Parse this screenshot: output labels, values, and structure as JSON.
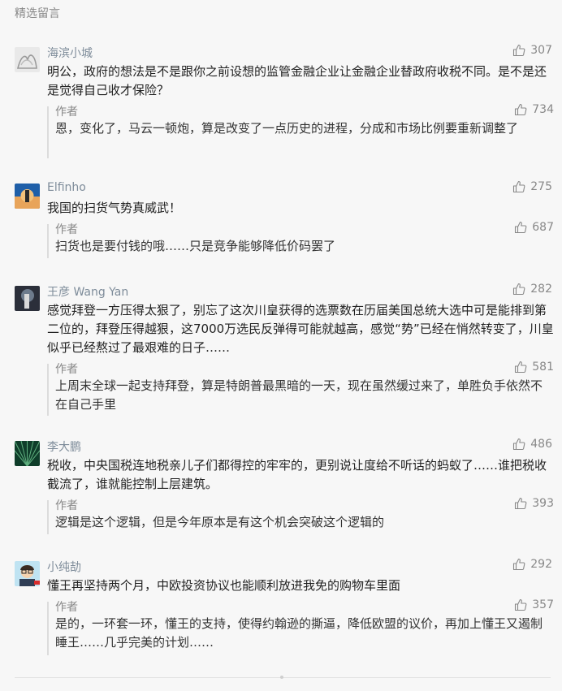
{
  "section_title": "精选留言",
  "comments": [
    {
      "name": "海滨小城",
      "likes": "307",
      "text": "明公，政府的想法是不是跟你之前设想的监管金融企业让金融企业替政府收税不同。是不是还是觉得自己收才保险？",
      "reply": {
        "author": "作者",
        "likes": "734",
        "text": "恩，变化了，马云一顿炮，算是改变了一点历史的进程，分成和市场比例要重新调整了"
      }
    },
    {
      "name": "Elfinho",
      "likes": "275",
      "text": "我国的扫货气势真威武！",
      "reply": {
        "author": "作者",
        "likes": "687",
        "text": "扫货也是要付钱的哦……只是竞争能够降低价码罢了"
      }
    },
    {
      "name": "王彦 Wang Yan",
      "likes": "282",
      "text": "感觉拜登一方压得太狠了，别忘了这次川皇获得的选票数在历届美国总统大选中可是能排到第二位的，拜登压得越狠，这7000万选民反弹得可能就越高，感觉“势”已经在悄然转变了，川皇似乎已经熬过了最艰难的日子……",
      "reply": {
        "author": "作者",
        "likes": "581",
        "text": "上周末全球一起支持拜登，算是特朗普最黑暗的一天，现在虽然缓过来了，单胜负手依然不在自己手里"
      }
    },
    {
      "name": "李大鹏",
      "likes": "486",
      "text": "税收，中央国税连地税亲儿子们都得控的牢牢的，更别说让度给不听话的蚂蚁了……谁把税收截流了，谁就能控制上层建筑。",
      "reply": {
        "author": "作者",
        "likes": "393",
        "text": "逻辑是这个逻辑，但是今年原本是有这个机会突破这个逻辑的"
      }
    },
    {
      "name": "小纯劼",
      "likes": "292",
      "text": "懂王再坚持两个月，中欧投资协议也能顺利放进我免的购物车里面",
      "reply": {
        "author": "作者",
        "likes": "357",
        "text": "是的，一环套一环，懂王的支持，使得约翰逊的撕逼，降低欧盟的议价，再加上懂王又遏制睡王……几乎完美的计划……"
      }
    }
  ]
}
